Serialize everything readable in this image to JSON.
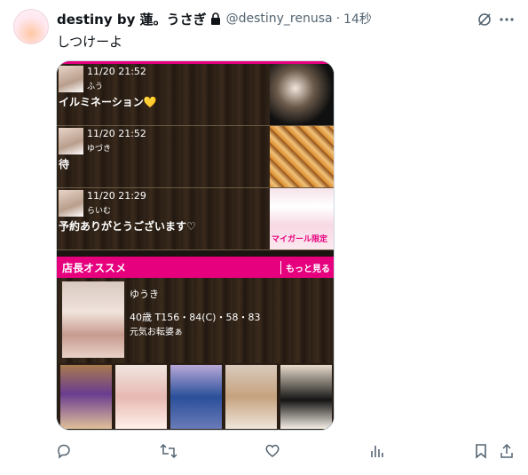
{
  "tweet": {
    "display_name": "destiny by 蓮。うさぎ",
    "handle": "@destiny_renusa",
    "separator": "·",
    "time": "14秒",
    "text": "しつけーよ"
  },
  "embedded": {
    "posts": [
      {
        "time": "11/20 21:52",
        "name": "ふう",
        "message": "イルミネーション💛"
      },
      {
        "time": "11/20 21:52",
        "name": "ゆづき",
        "message": "待"
      },
      {
        "time": "11/20 21:29",
        "name": "らいむ",
        "message": "予約ありがとうございます♡"
      }
    ],
    "side_banner_text": "マイガール限定",
    "section_title": "店長オススメ",
    "more_link": "もっと見る",
    "featured": {
      "name": "ゆうき",
      "specs": "40歳 T156・84(C)・58・83",
      "note": "元気お転婆ぁ"
    }
  },
  "actions": [
    "reply-icon",
    "retweet-icon",
    "like-icon",
    "views-icon",
    "bookmark-icon",
    "share-icon"
  ]
}
